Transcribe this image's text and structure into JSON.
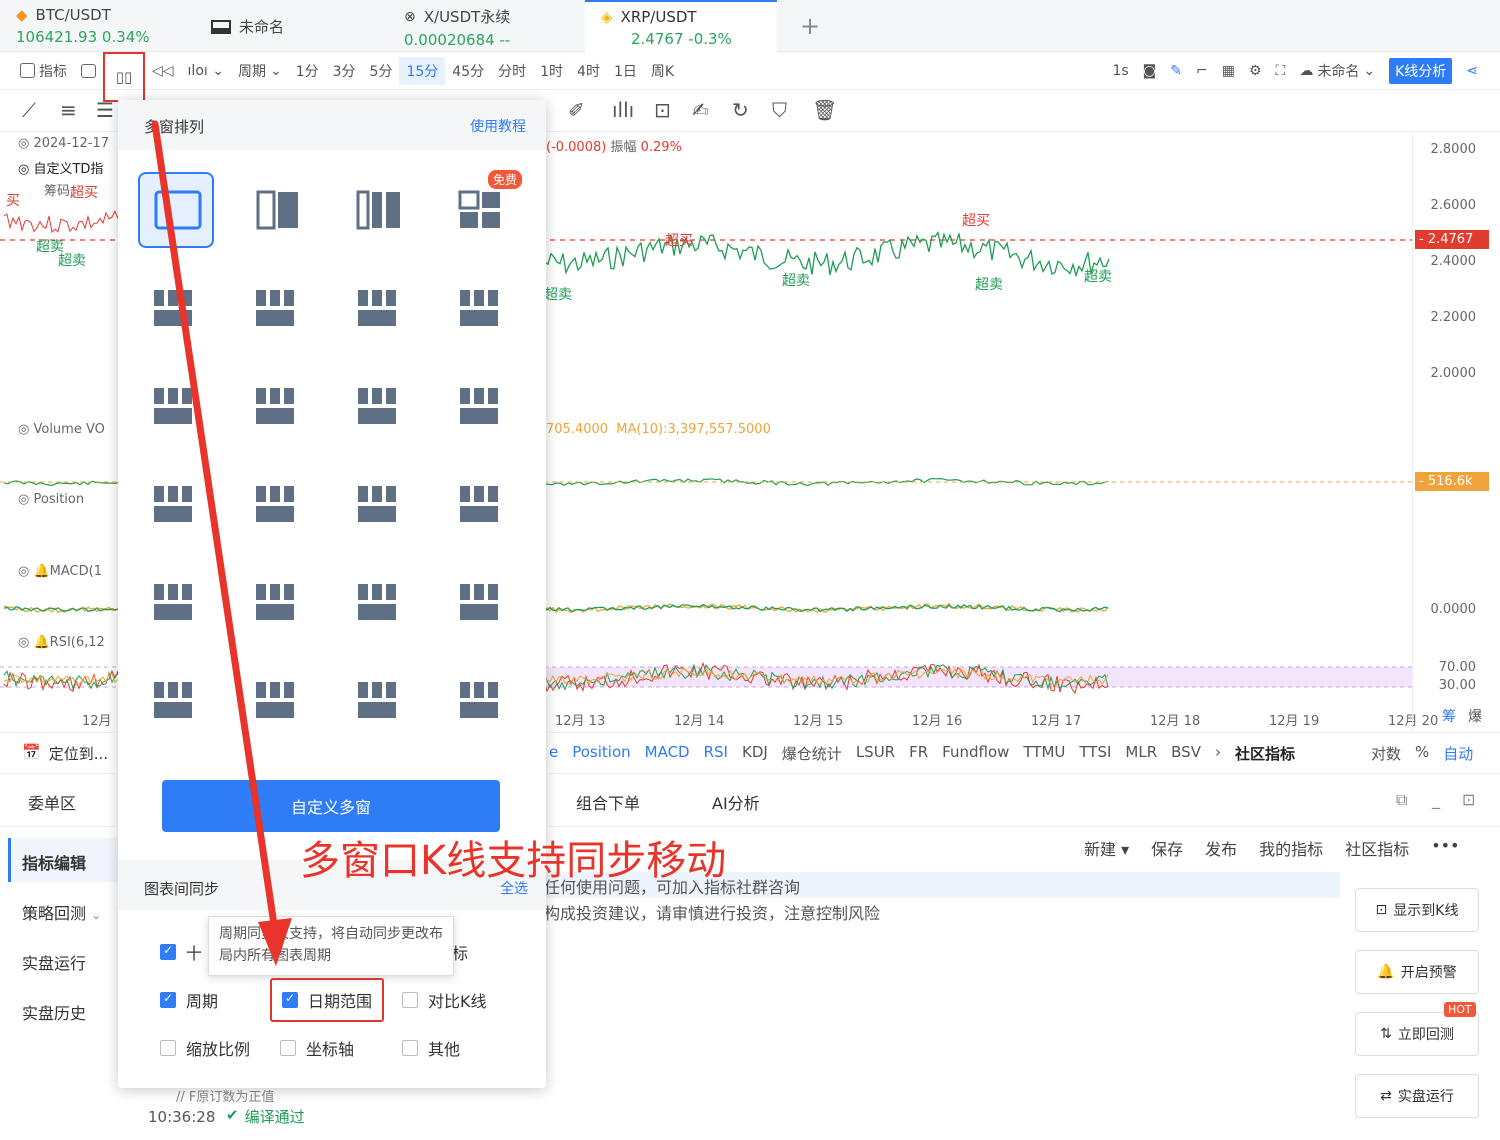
{
  "tabs": [
    {
      "symbol": "BTC/USDT",
      "price": "106421.93",
      "change": "0.34%"
    },
    {
      "symbol": "未命名",
      "price": "",
      "change": ""
    },
    {
      "symbol": "X/USDT永续",
      "price": "0.00020684",
      "change": "--"
    },
    {
      "symbol": "XRP/USDT",
      "price": "2.4767",
      "change": "-0.3%"
    }
  ],
  "add_tab": "+",
  "toolbar": {
    "indicator": "指标",
    "period": "周期",
    "intervals": [
      "1分",
      "3分",
      "5分",
      "15分",
      "45分",
      "分时",
      "1时",
      "4时",
      "1日",
      "周K"
    ],
    "selected_interval": "15分",
    "sec": "1s",
    "unnamed": "未命名",
    "kline_analysis": "K线分析"
  },
  "chart": {
    "date_label": "2024-12-17",
    "td_label": "自定义TD指",
    "chip_label": "筹码",
    "change_info": "(-0.0008)",
    "amplitude_label": "振幅",
    "amplitude": "0.29%",
    "overbought": "超买",
    "oversold": "超卖",
    "buy": "买",
    "price_ticks": [
      "2.8000",
      "2.6000",
      "2.4000",
      "2.2000",
      "2.0000"
    ],
    "current_price": "2.4767",
    "volume_label": "Volume VO",
    "volume_info": "705.4000",
    "ma10": "MA(10):3,397,557.5000",
    "volume_tag": "516.6k",
    "position_label": "Position",
    "macd_label": "MACD(1",
    "macd_zero": "0.0000",
    "rsi_label": "RSI(6,12",
    "rsi_ticks": [
      "70.00",
      "30.00"
    ],
    "dates": [
      "12月",
      "12月 13",
      "12月 14",
      "12月 15",
      "12月 16",
      "12月 17",
      "12月 18",
      "12月 19",
      "12月 20"
    ],
    "chip": "筹",
    "burst": "爆"
  },
  "indicators": {
    "locate": "定位到...",
    "items": [
      "e",
      "Position",
      "MACD",
      "RSI",
      "KDJ",
      "爆仓统计",
      "LSUR",
      "FR",
      "Fundflow",
      "TTMU",
      "TTSI",
      "MLR",
      "BSV"
    ],
    "community": "社区指标",
    "log": "对数",
    "pct": "%",
    "auto": "自动"
  },
  "bottom": {
    "order_area": "委单区",
    "tabs": [
      "组合下单",
      "AI分析"
    ],
    "side": [
      "指标编辑",
      "策略回测",
      "实盘运行",
      "实盘历史"
    ],
    "editor_actions": [
      "新建",
      "保存",
      "发布",
      "我的指标",
      "社区指标"
    ],
    "info1": "任何使用问题，可加入指标社群咨询",
    "info2": "构成投资建议，请审慎进行投资，注意控制风险",
    "right_buttons": [
      "显示到K线",
      "开启预警",
      "立即回测",
      "实盘运行"
    ],
    "hot": "HOT",
    "time": "10:36:28",
    "compile_ok": "编译通过",
    "code_line": "//  F原订数为正值"
  },
  "popup": {
    "title": "多窗排列",
    "tutorial": "使用教程",
    "free": "免费",
    "custom_btn": "自定义多窗",
    "sync_title": "图表间同步",
    "select_all": "全选",
    "tooltip": "周期同步仅支持，将自动同步更改布局内所有图表周期",
    "opt_cross": "十",
    "opt_cross_tail": "标",
    "opt_period": "周期",
    "opt_date": "日期范围",
    "opt_compare": "对比K线",
    "opt_zoom": "缩放比例",
    "opt_axis": "坐标轴",
    "opt_other": "其他"
  },
  "annotation": "多窗口K线支持同步移动"
}
